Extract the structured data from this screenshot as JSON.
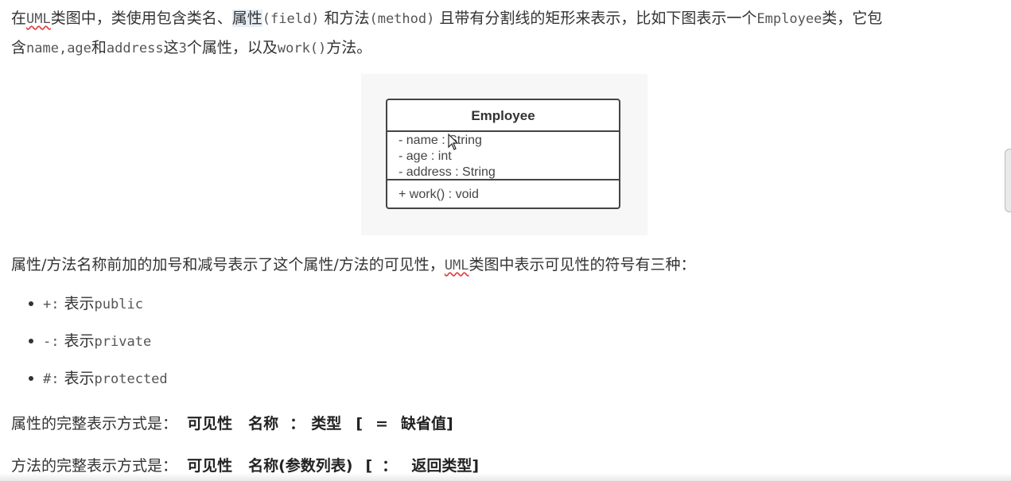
{
  "para1": {
    "line1": {
      "t1": "在",
      "uml": "UML",
      "t2": "类图中，类使用包含类名、",
      "hl": "属性",
      "c1": "(field)",
      "t3": " 和方法",
      "c2": "(method)",
      "t4": " 且带有分割线的矩形来表示，比如下图表示一个",
      "c3": "Employee",
      "t5": "类，它包"
    },
    "line2": {
      "t1": "含",
      "c1": "name,age",
      "t2": "和",
      "c2": "address",
      "t3": "这",
      "c3": "3",
      "t4": "个属性，以及",
      "c4": "work()",
      "t5": "方法。"
    }
  },
  "diagram": {
    "class_name": "Employee",
    "attributes": [
      "- name : String",
      "- age : int",
      "- address : String"
    ],
    "method": "+ work() : void"
  },
  "para2": {
    "t1": "属性/方法名称前加的加号和减号表示了这个属性/方法的可见性，",
    "uml": "UML",
    "t2": "类图中表示可见性的符号有三种："
  },
  "bullets": [
    {
      "symbol": "+:",
      "text": " 表示",
      "code": "public"
    },
    {
      "symbol": "-:",
      "text": " 表示",
      "code": "private"
    },
    {
      "symbol": "#:",
      "text": " 表示",
      "code": "protected"
    }
  ],
  "attr_format": {
    "label": "属性的完整表示方式是：",
    "f1": "可见性",
    "f2": "名称",
    "f3": "：",
    "f4": "类型",
    "f5": "[",
    "f6": "=",
    "f7": "缺省值]"
  },
  "method_format": {
    "label": "方法的完整表示方式是：",
    "f1": "可见性",
    "f2": "名称(参数列表)",
    "f3": "[",
    "f4": "：",
    "f5": "返回类型]"
  }
}
